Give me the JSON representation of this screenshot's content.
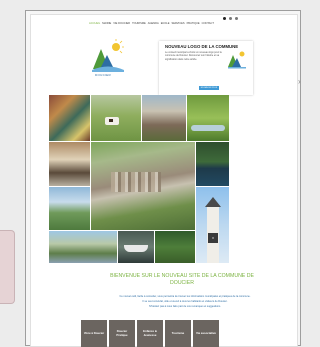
{
  "nav": {
    "items": [
      "ACCUEIL",
      "MAIRIE",
      "VIE DOUCIER",
      "TOURISME",
      "AGENDA",
      "ECOLE",
      "SERVICES",
      "PRATIQUE",
      "CONTACT"
    ]
  },
  "banner": {
    "logo_caption": "DOUCIER",
    "news_title": "NOUVEAU LOGO DE LA COMMUNE",
    "news_text": "Le conseil municipal a choisi un nouveau logo pour la commune de Doucier. Découvrez son histoire et sa signification dans notre article.",
    "news_button": "EN SAVOIR PLUS"
  },
  "welcome": {
    "title_line1": "BIENVENUE SUR LE NOUVEAU SITE DE LA COMMUNE DE",
    "title_line2": "DOUCIER",
    "p1": "Ce nouvel outil, facile à consulter, vous permettra de trouver les informations municipales et pratiques de la commune.",
    "p2": "Il se veut convivial, utile et ouvert à tous les habitants et visiteurs de Doucier.",
    "p3": "N'hésitez pas à nous faire part de vos remarques et suggestions."
  },
  "bottom_bar": {
    "tiles": [
      "Vivre à Doucier",
      "Doucier Pratique",
      "Enfance & Jeunesse",
      "Tourisme",
      "Vie associative"
    ]
  },
  "colors": {
    "accent_green": "#7cb342",
    "accent_blue": "#2d6da3",
    "tile_bg": "#6b6560"
  }
}
